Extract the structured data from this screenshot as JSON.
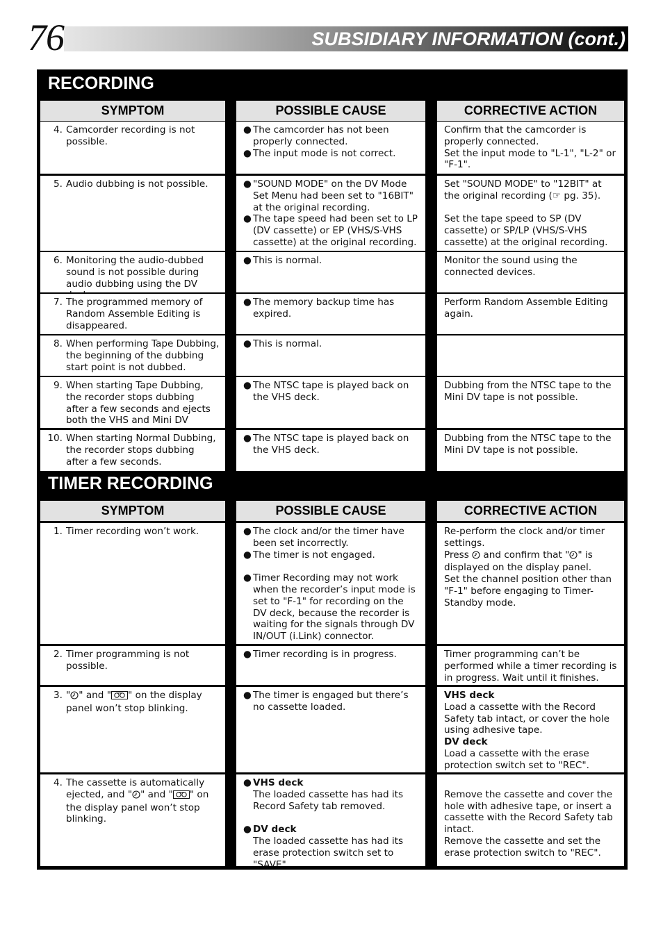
{
  "page": {
    "number": "76",
    "title": "SUBSIDIARY INFORMATION (cont.)"
  },
  "columns": {
    "symptom": "SYMPTOM",
    "cause": "POSSIBLE CAUSE",
    "action": "CORRECTIVE ACTION"
  },
  "recording": {
    "title": "RECORDING",
    "rows": [
      {
        "num": "4.",
        "symptom": "Camcorder recording is not possible.",
        "causes": [
          "The camcorder has not been properly connected.",
          "The input mode is not correct."
        ],
        "action": [
          "Confirm that the camcorder is properly connected.",
          "Set the input mode to \"L-1\", \"L-2\" or \"F-1\"."
        ]
      },
      {
        "num": "5.",
        "symptom": "Audio dubbing is not possible.",
        "causes": [
          "\"SOUND MODE\" on the DV Mode Set Menu had been set to \"16BIT\" at the original recording.",
          "The tape speed had been set to LP (DV cassette) or EP (VHS/S-VHS cassette) at the original recording."
        ],
        "action": [
          "Set \"SOUND MODE\" to \"12BIT\" at the original recording (☞ pg. 35).",
          "",
          "Set the tape speed to SP (DV cassette) or SP/LP (VHS/S-VHS cassette) at the original recording."
        ]
      },
      {
        "num": "6.",
        "symptom": "Monitoring the audio-dubbed sound is not possible during audio dubbing using the DV deck.",
        "causes": [
          "This is normal."
        ],
        "action": [
          "Monitor the sound using the connected devices."
        ]
      },
      {
        "num": "7.",
        "symptom": "The programmed memory of Random Assemble Editing is disappeared.",
        "causes": [
          "The memory backup time has expired."
        ],
        "action": [
          "Perform Random Assemble Editing again."
        ]
      },
      {
        "num": "8.",
        "symptom": "When performing Tape Dubbing, the beginning of the dubbing start point is not dubbed.",
        "causes": [
          "This is normal."
        ],
        "action": []
      },
      {
        "num": "9.",
        "symptom": "When starting Tape Dubbing, the recorder stops dubbing after a few seconds and ejects both the VHS and Mini DV tapes.",
        "causes": [
          "The NTSC tape is played back on the VHS deck."
        ],
        "action": [
          "Dubbing from the NTSC tape to the Mini DV tape is not possible."
        ]
      },
      {
        "num": "10.",
        "symptom": "When starting Normal Dubbing, the recorder stops dubbing after a few seconds.",
        "causes": [
          "The NTSC tape is played back on the VHS deck."
        ],
        "action": [
          "Dubbing from the NTSC tape to the Mini DV tape is not possible."
        ]
      }
    ]
  },
  "timer": {
    "title": "TIMER RECORDING",
    "row1": {
      "num": "1.",
      "symptom": "Timer recording won’t work.",
      "cause_a": "The clock and/or the timer have been set incorrectly.",
      "cause_b": "The timer is not engaged.",
      "cause_c": "Timer Recording may not work when the recorder’s input mode is set to \"F-1\" for recording on the DV deck, because the recorder is waiting for the signals through DV IN/OUT (i.Link) connector.",
      "action_a": "Re-perform the clock and/or timer settings.",
      "action_b1": "Press ",
      "action_b2": " and confirm that \"",
      "action_b3": "\" is displayed on the display panel.",
      "action_c": "Set the channel position other than \"F-1\" before engaging to Timer-Standby mode."
    },
    "row2": {
      "num": "2.",
      "symptom": "Timer programming is not possible.",
      "cause": "Timer recording is in progress.",
      "action": "Timer programming can’t be performed while a timer recording is in progress. Wait until it finishes."
    },
    "row3": {
      "num": "3.",
      "symptom_a": "\"",
      "symptom_b": "\" and \"",
      "symptom_c": "\" on the display panel won’t stop blinking.",
      "cause": "The timer is engaged but there’s no cassette loaded.",
      "action_vhs_label": "VHS deck",
      "action_vhs": "Load a cassette with the Record Safety tab intact, or cover the hole using adhesive tape.",
      "action_dv_label": "DV deck",
      "action_dv": "Load a cassette with the erase protection switch set to \"REC\"."
    },
    "row4": {
      "num": "4.",
      "symptom_a": "The cassette is automatically ejected, and \"",
      "symptom_b": "\" and \"",
      "symptom_c": "\" on the display panel won’t stop blinking.",
      "cause_vhs_label": "VHS deck",
      "cause_vhs": "The loaded cassette has had its Record Safety tab removed.",
      "cause_dv_label": "DV deck",
      "cause_dv": "The loaded cassette has had its erase protection switch set to \"SAVE\".",
      "action_a": "Remove the cassette and cover the hole with adhesive tape, or insert a cassette with the Record Safety tab intact.",
      "action_b": "Remove the cassette and set the erase protection switch to \"REC\"."
    }
  },
  "symbols": {
    "bullet": "●",
    "timer_icon": "timer-icon",
    "cassette_icon": "cassette-icon"
  }
}
